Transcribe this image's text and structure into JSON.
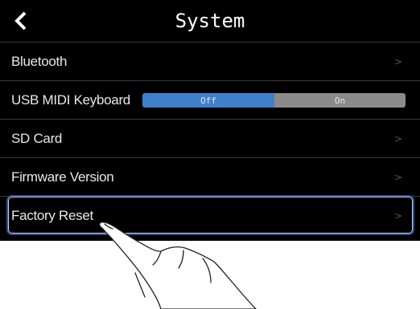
{
  "header": {
    "title": "System",
    "back_icon": "chevron-left-icon"
  },
  "menu": {
    "items": [
      {
        "label": "Bluetooth",
        "chevron": ">"
      },
      {
        "label": "USB MIDI Keyboard",
        "toggle": {
          "options": [
            "Off",
            "On"
          ],
          "selected": "Off"
        }
      },
      {
        "label": "SD Card",
        "chevron": ">"
      },
      {
        "label": "Firmware Version",
        "chevron": ">"
      },
      {
        "label": "Factory Reset",
        "chevron": ">",
        "highlighted": true
      }
    ]
  },
  "colors": {
    "background": "#000000",
    "toggle_selected": "#3f80cc",
    "toggle_unselected": "#8a8a8a",
    "highlight_border": "#2f4e8a"
  },
  "gesture": {
    "icon": "tap-hand-icon"
  }
}
